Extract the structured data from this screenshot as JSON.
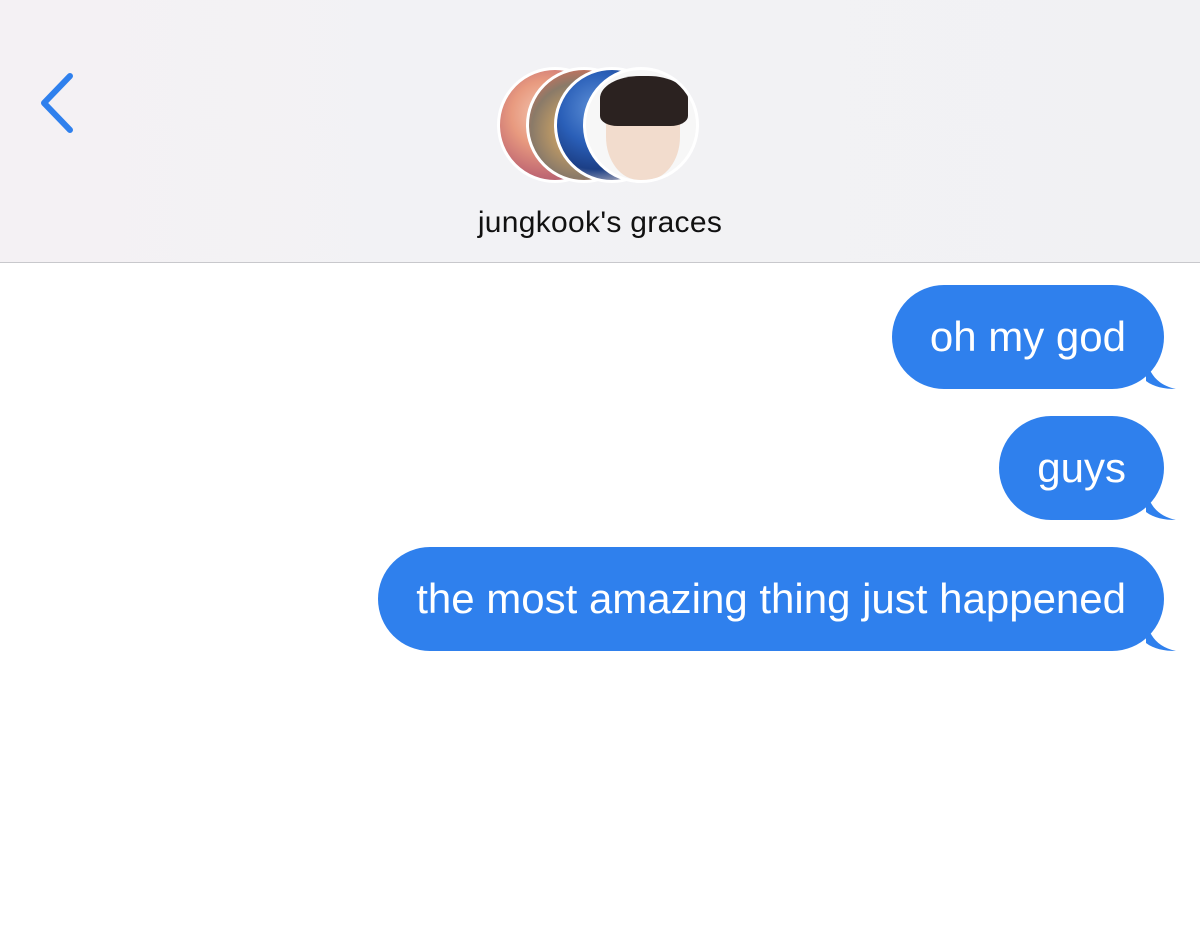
{
  "header": {
    "title": "jungkook's graces",
    "back_icon": "chevron-left-icon",
    "accent_color": "#2f80ed"
  },
  "avatars": [
    {
      "name": "avatar-1"
    },
    {
      "name": "avatar-2"
    },
    {
      "name": "avatar-3"
    },
    {
      "name": "avatar-4"
    }
  ],
  "messages": [
    {
      "text": "oh my god",
      "direction": "outgoing"
    },
    {
      "text": "guys",
      "direction": "outgoing"
    },
    {
      "text": "the most amazing thing just happened",
      "direction": "outgoing"
    }
  ],
  "bubble_color": "#2f80ed"
}
